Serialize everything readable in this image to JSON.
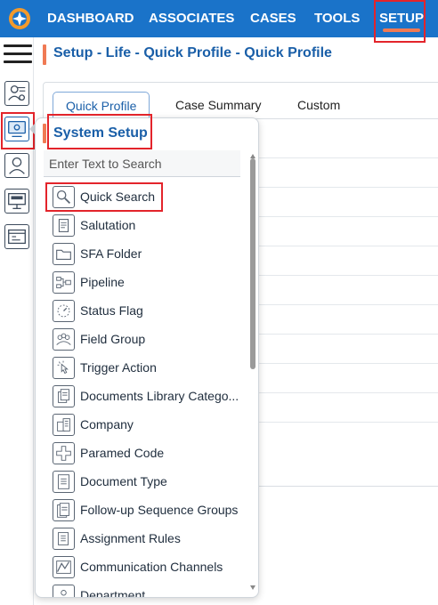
{
  "topnav": {
    "items": [
      {
        "label": "DASHBOARD"
      },
      {
        "label": "ASSOCIATES"
      },
      {
        "label": "CASES"
      },
      {
        "label": "TOOLS"
      },
      {
        "label": "SETUP",
        "active": true
      }
    ],
    "bg_color": "#1a73c9",
    "accent_color": "#f07a54"
  },
  "rail": {
    "icons": [
      "profile-settings-icon",
      "system-setup-icon",
      "person-icon",
      "monitor-icon",
      "window-list-icon"
    ]
  },
  "breadcrumb": {
    "text": "Setup - Life - Quick Profile - Quick Profile"
  },
  "main": {
    "tabs": [
      {
        "label": "Quick Profile",
        "active": true
      },
      {
        "label": "Case Summary"
      },
      {
        "label": "Custom"
      }
    ]
  },
  "flyout": {
    "title": "System Setup",
    "search_placeholder": "Enter Text to Search",
    "items": [
      {
        "label": "Quick Search",
        "icon": "magnifier-icon"
      },
      {
        "label": "Salutation",
        "icon": "scroll-icon"
      },
      {
        "label": "SFA Folder",
        "icon": "folder-icon"
      },
      {
        "label": "Pipeline",
        "icon": "pipeline-icon"
      },
      {
        "label": "Status Flag",
        "icon": "status-dial-icon"
      },
      {
        "label": "Field Group",
        "icon": "group-icon"
      },
      {
        "label": "Trigger Action",
        "icon": "click-icon"
      },
      {
        "label": "Documents Library Catego...",
        "icon": "documents-icon"
      },
      {
        "label": "Company",
        "icon": "company-icon"
      },
      {
        "label": "Paramed Code",
        "icon": "medical-icon"
      },
      {
        "label": "Document Type",
        "icon": "document-icon"
      },
      {
        "label": "Follow-up Sequence Groups",
        "icon": "document-stack-icon"
      },
      {
        "label": "Assignment Rules",
        "icon": "rules-icon"
      },
      {
        "label": "Communication Channels",
        "icon": "channels-icon"
      },
      {
        "label": "Department",
        "icon": "department-icon"
      }
    ]
  },
  "highlight_color": "#e3242b"
}
